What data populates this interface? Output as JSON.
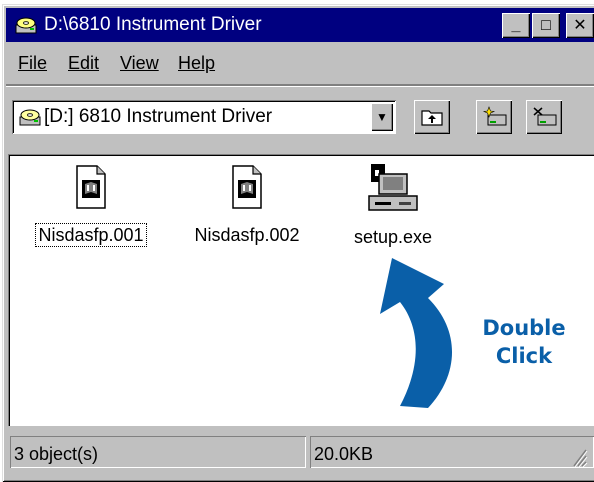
{
  "window": {
    "title": "D:\\6810 Instrument Driver",
    "controls": {
      "minimize": "_",
      "maximize": "□",
      "close": "✕"
    }
  },
  "menu": [
    {
      "label": "File"
    },
    {
      "label": "Edit"
    },
    {
      "label": "View"
    },
    {
      "label": "Help"
    }
  ],
  "toolbar": {
    "address": "[D:] 6810 Instrument Driver",
    "icons": [
      "drive-icon",
      "up-folder-icon",
      "map-network-drive-icon",
      "disconnect-network-drive-icon"
    ]
  },
  "files": [
    {
      "name": "Nisdasfp.001",
      "icon": "document-icon",
      "focused": true
    },
    {
      "name": "Nisdasfp.002",
      "icon": "document-icon",
      "focused": false
    },
    {
      "name": "setup.exe",
      "icon": "setup-program-icon",
      "focused": false
    }
  ],
  "annotation": {
    "line1": "Double",
    "line2": "Click",
    "color": "#0a5fa8"
  },
  "status": {
    "objects": "3 object(s)",
    "size": "20.0KB"
  },
  "colors": {
    "titlebar": "#000080",
    "face": "#c0c0c0",
    "arrow": "#0a5fa8"
  }
}
